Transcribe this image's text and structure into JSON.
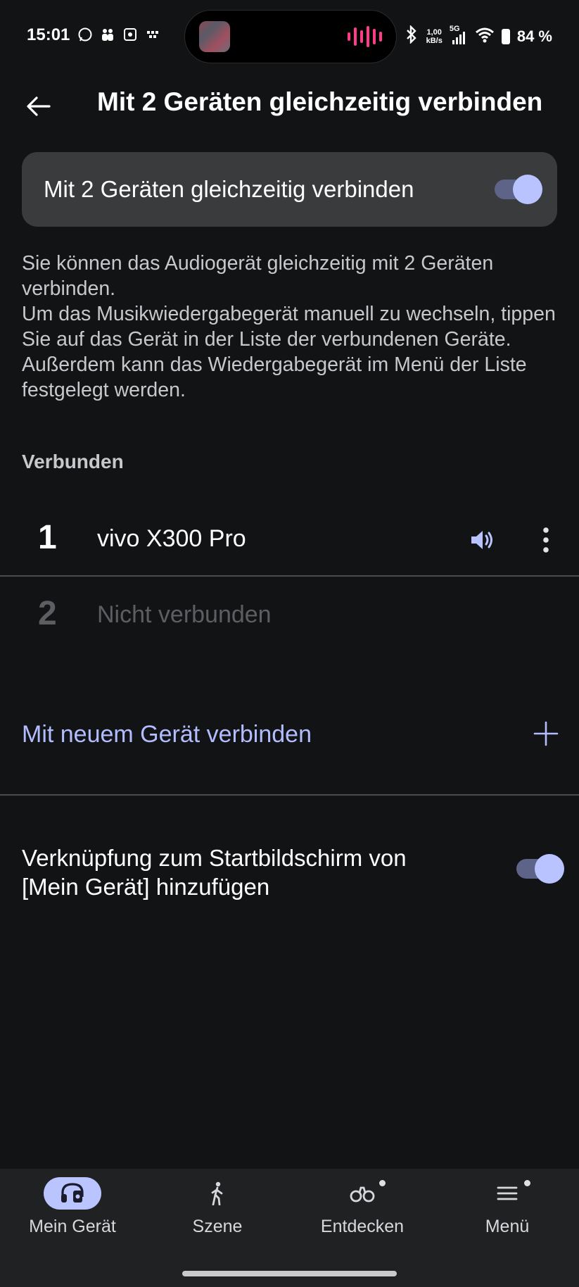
{
  "status_bar": {
    "time": "15:01",
    "network_speed": "1,00",
    "network_speed_unit": "kB/s",
    "network_type": "5G",
    "battery": "84 %"
  },
  "header": {
    "title": "Mit 2 Geräten gleichzeitig verbinden"
  },
  "main_toggle": {
    "label": "Mit 2 Geräten gleichzeitig verbinden",
    "enabled": true
  },
  "description": {
    "line1": "Sie können das Audiogerät gleichzeitig mit 2 Geräten verbinden.",
    "line2": "Um das Musikwiedergabegerät manuell zu wechseln, tippen Sie auf das Gerät in der Liste der verbundenen Geräte. Außerdem kann das Wiedergabegerät im Menü der Liste festgelegt werden."
  },
  "connected_section": {
    "heading": "Verbunden",
    "devices": [
      {
        "number": "1",
        "name": "vivo X300 Pro",
        "connected": true
      },
      {
        "number": "2",
        "name": "Nicht verbunden",
        "connected": false
      }
    ]
  },
  "connect_new": {
    "label": "Mit neuem Gerät verbinden"
  },
  "shortcut": {
    "label": "Verknüpfung zum Startbildschirm von [Mein Gerät] hinzufügen",
    "enabled": true
  },
  "bottom_nav": {
    "items": [
      {
        "label": "Mein Gerät",
        "icon": "headphones-icon",
        "active": true
      },
      {
        "label": "Szene",
        "icon": "walking-person-icon",
        "active": false
      },
      {
        "label": "Entdecken",
        "icon": "binoculars-icon",
        "active": false
      },
      {
        "label": "Menü",
        "icon": "hamburger-menu-icon",
        "active": false
      }
    ]
  },
  "colors": {
    "background": "#121314",
    "card": "#3a3b3d",
    "accent": "#b8c3ff",
    "switch_track": "#5d6488",
    "link": "#b2bcff",
    "waveform": "#ff3b8a"
  }
}
